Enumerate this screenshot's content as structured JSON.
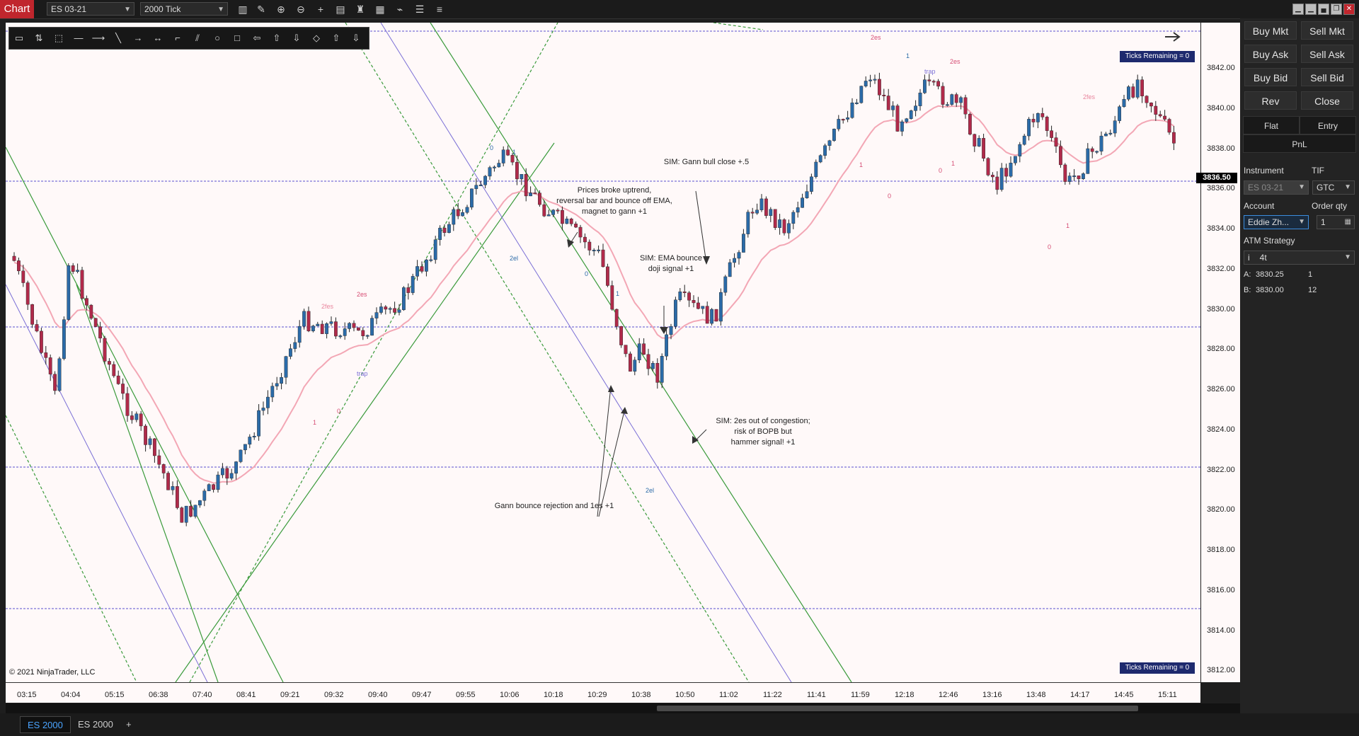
{
  "window": {
    "title_badge": "Chart",
    "instrument_select": "ES 03-21",
    "bartype_select": "2000 Tick",
    "toolbar_icons": [
      "bars-icon",
      "pencil-icon",
      "zoom-in-icon",
      "zoom-out-icon",
      "crosshair-icon",
      "properties-icon",
      "strategies-icon",
      "indicators-icon",
      "templates-icon",
      "list-icon"
    ],
    "window_controls": [
      "minimize-icon",
      "restore-icon",
      "pin-icon",
      "maximize-icon",
      "close-icon"
    ]
  },
  "drawing_toolbar": {
    "icons": [
      "ruler-icon",
      "risk-reward-icon",
      "region-icon",
      "line-icon",
      "ray-icon",
      "extended-line-icon",
      "arrow-line-icon",
      "horizontal-line-icon",
      "gann-fan-icon",
      "andrews-pitchfork-icon",
      "ellipse-icon",
      "rectangle-icon",
      "text-icon",
      "arrow-up-icon",
      "arrow-down-icon",
      "diamond-icon",
      "triangle-up-icon",
      "triangle-down-icon"
    ]
  },
  "chart": {
    "copyright": "© 2021 NinjaTrader, LLC",
    "ticks_remaining_top": "Ticks Remaining = 0",
    "ticks_remaining_bottom": "Ticks Remaining = 0",
    "current_price": "3836.50",
    "y_ticks": [
      "3842.00",
      "3840.00",
      "3838.00",
      "3836.00",
      "3834.00",
      "3832.00",
      "3830.00",
      "3828.00",
      "3826.00",
      "3824.00",
      "3822.00",
      "3820.00",
      "3818.00",
      "3816.00",
      "3814.00",
      "3812.00"
    ],
    "x_ticks": [
      "03:15",
      "04:04",
      "05:15",
      "06:38",
      "07:40",
      "08:41",
      "09:21",
      "09:32",
      "09:40",
      "09:47",
      "09:55",
      "10:06",
      "10:18",
      "10:29",
      "10:38",
      "10:50",
      "11:02",
      "11:22",
      "11:41",
      "11:59",
      "12:18",
      "12:46",
      "13:16",
      "13:48",
      "14:17",
      "14:45",
      "15:11"
    ],
    "annotations": {
      "a1": "Prices broke uptrend,",
      "a2": "reversal bar and bounce off EMA,",
      "a3": "magnet to gann +1",
      "b1": "SIM: Gann bull close +.5",
      "c1": "SIM: EMA bounce",
      "c2": "doji signal +1",
      "d1": "SIM: 2es out of congestion;",
      "d2": "risk of BOPB but",
      "d3": "hammer signal! +1",
      "e1": "Gann bounce rejection and 1es +1"
    },
    "signal_labels": [
      "2fes",
      "2es",
      "trap",
      "1",
      "0",
      "2el",
      "2es",
      "2fes",
      "trap",
      "1",
      "0",
      "2el",
      "1",
      "0",
      "1",
      "0",
      "2es",
      "1",
      "0",
      "1",
      "0",
      "1"
    ],
    "colors": {
      "background": "#fff9f9",
      "up_candle": "#2b6ba8",
      "down_candle": "#b02a4a",
      "ema": "#f3a7b5",
      "gann_line": "#3a9a3a",
      "purple_line": "#7b6fd6",
      "hline": "#5a4fd0"
    }
  },
  "tabs": {
    "items": [
      "ES 2000",
      "ES 2000"
    ],
    "add": "+"
  },
  "order_panel": {
    "buy_mkt": "Buy Mkt",
    "sell_mkt": "Sell Mkt",
    "buy_ask": "Buy Ask",
    "sell_ask": "Sell Ask",
    "buy_bid": "Buy Bid",
    "sell_bid": "Sell Bid",
    "rev": "Rev",
    "close": "Close",
    "flat": "Flat",
    "entry": "Entry",
    "pnl": "PnL",
    "instrument_label": "Instrument",
    "instrument_value": "ES 03-21",
    "tif_label": "TIF",
    "tif_value": "GTC",
    "account_label": "Account",
    "account_value": "Eddie Zh...",
    "qty_label": "Order qty",
    "qty_value": "1",
    "atm_label": "ATM Strategy",
    "atm_value": "4t",
    "ask_label": "A:",
    "ask_price": "3830.25",
    "ask_size": "1",
    "bid_label": "B:",
    "bid_price": "3830.00",
    "bid_size": "12"
  }
}
